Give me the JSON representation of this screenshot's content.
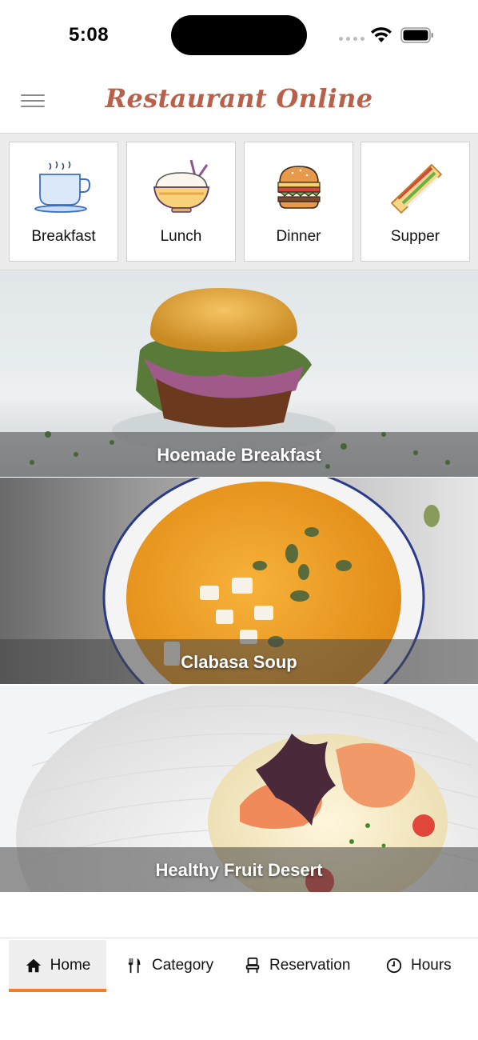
{
  "status_bar": {
    "time": "5:08"
  },
  "header": {
    "title": "Restaurant Online",
    "menu_icon": "hamburger-menu-icon"
  },
  "categories": [
    {
      "label": "Breakfast",
      "icon": "coffee-cup-icon"
    },
    {
      "label": "Lunch",
      "icon": "rice-bowl-icon"
    },
    {
      "label": "Dinner",
      "icon": "burger-icon"
    },
    {
      "label": "Supper",
      "icon": "sandwich-icon"
    }
  ],
  "features": [
    {
      "caption": "Hoemade Breakfast",
      "image": "burger-photo"
    },
    {
      "caption": "Clabasa Soup",
      "image": "pumpkin-soup-photo"
    },
    {
      "caption": "Healthy Fruit Desert",
      "image": "shrimp-dish-photo"
    }
  ],
  "tabs": [
    {
      "label": "Home",
      "icon": "home-icon",
      "active": true
    },
    {
      "label": "Category",
      "icon": "fork-knife-icon",
      "active": false
    },
    {
      "label": "Reservation",
      "icon": "chair-icon",
      "active": false
    },
    {
      "label": "Hours",
      "icon": "clock-icon",
      "active": false
    }
  ],
  "colors": {
    "title": "#b8604a",
    "tab_underline": "#f57c20"
  }
}
